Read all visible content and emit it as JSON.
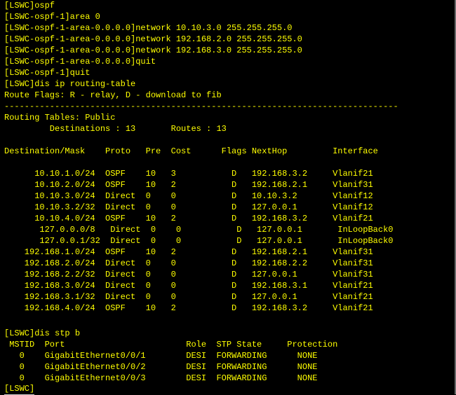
{
  "terminal": {
    "lines": [
      "[LSWC]ospf",
      "[LSWC-ospf-1]area 0",
      "[LSWC-ospf-1-area-0.0.0.0]network 10.10.3.0 255.255.255.0",
      "[LSWC-ospf-1-area-0.0.0.0]network 192.168.2.0 255.255.255.0",
      "[LSWC-ospf-1-area-0.0.0.0]network 192.168.3.0 255.255.255.0",
      "[LSWC-ospf-1-area-0.0.0.0]quit",
      "[LSWC-ospf-1]quit",
      "[LSWC]dis ip routing-table",
      "Route Flags: R - relay, D - download to fib",
      "------------------------------------------------------------------------------",
      "Routing Tables: Public",
      "         Destinations : 13       Routes : 13",
      "",
      "Destination/Mask    Proto   Pre  Cost      Flags NextHop         Interface",
      "",
      "      10.10.1.0/24  OSPF    10   3           D   192.168.3.2     Vlanif21",
      "      10.10.2.0/24  OSPF    10   2           D   192.168.2.1     Vlanif31",
      "      10.10.3.0/24  Direct  0    0           D   10.10.3.2       Vlanif12",
      "      10.10.3.2/32  Direct  0    0           D   127.0.0.1       Vlanif12",
      "      10.10.4.0/24  OSPF    10   2           D   192.168.3.2     Vlanif21",
      "       127.0.0.0/8   Direct  0    0           D   127.0.0.1       InLoopBack0",
      "       127.0.0.1/32  Direct  0    0           D   127.0.0.1       InLoopBack0",
      "    192.168.1.0/24  OSPF    10   2           D   192.168.2.1     Vlanif31",
      "    192.168.2.0/24  Direct  0    0           D   192.168.2.2     Vlanif31",
      "    192.168.2.2/32  Direct  0    0           D   127.0.0.1       Vlanif31",
      "    192.168.3.0/24  Direct  0    0           D   192.168.3.1     Vlanif21",
      "    192.168.3.1/32  Direct  0    0           D   127.0.0.1       Vlanif21",
      "    192.168.4.0/24  OSPF    10   2           D   192.168.3.2     Vlanif21",
      "",
      "[LSWC]dis stp b",
      " MSTID  Port                        Role  STP State     Protection",
      "   0    GigabitEthernet0/0/1        DESI  FORWARDING      NONE",
      "   0    GigabitEthernet0/0/2        DESI  FORWARDING      NONE",
      "   0    GigabitEthernet0/0/3        DESI  FORWARDING      NONE",
      "[LSWC]"
    ]
  }
}
